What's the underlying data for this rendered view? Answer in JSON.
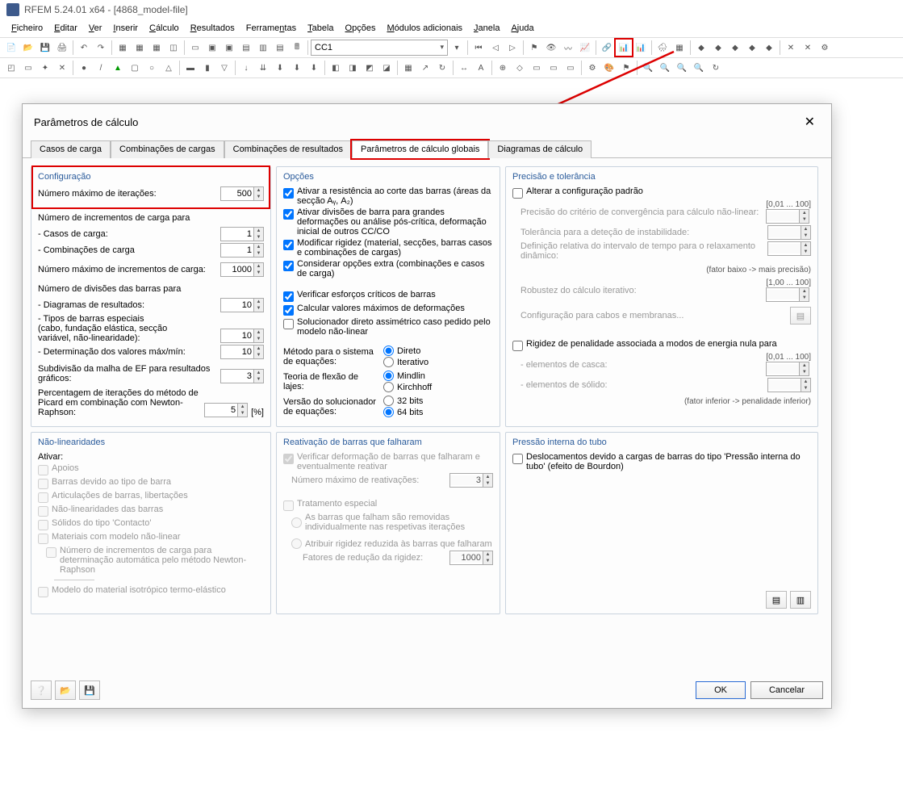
{
  "window": {
    "title": "RFEM 5.24.01 x64 - [4868_model-file]"
  },
  "menu": {
    "ficheiro": "Ficheiro",
    "editar": "Editar",
    "ver": "Ver",
    "inserir": "Inserir",
    "calculo": "Cálculo",
    "resultados": "Resultados",
    "ferramentas": "Ferramentas",
    "tabela": "Tabela",
    "opcoes": "Opções",
    "modulos": "Módulos adicionais",
    "janela": "Janela",
    "ajuda": "Ajuda"
  },
  "toolbar": {
    "combo_value": "CC1"
  },
  "dialog": {
    "title": "Parâmetros de cálculo",
    "close": "✕",
    "tabs": {
      "cces": "Casos de carga",
      "comb": "Combinações de cargas",
      "combres": "Combinações de resultados",
      "glob": "Parâmetros de cálculo globais",
      "diag": "Diagramas de cálculo"
    }
  },
  "config": {
    "hdr": "Configuração",
    "iter_lbl": "Número máximo de iterações:",
    "iter_val": "500",
    "incr_lbl": "Número de incrementos de carga para",
    "casos_lbl": "- Casos de carga:",
    "casos_val": "1",
    "comb_lbl": "- Combinações de carga",
    "comb_val": "1",
    "maxincr_lbl": "Número máximo de incrementos de carga:",
    "maxincr_val": "1000",
    "div_lbl": "Número de divisões das barras para",
    "diag_lbl": "- Diagramas de resultados:",
    "diag_val": "10",
    "tipos_lbl": "- Tipos de barras especiais\n  (cabo, fundação elástica, secção\n  variável, não-linearidade):",
    "tipos_val": "10",
    "det_lbl": "- Determinação dos valores máx/mín:",
    "det_val": "10",
    "malha_lbl": "Subdivisão da malha de EF para resultados gráficos:",
    "malha_val": "3",
    "pic_lbl": "Percentagem de iterações do método de Picard em combinação com Newton-Raphson:",
    "pic_val": "5",
    "pic_unit": "[%]"
  },
  "options": {
    "hdr": "Opções",
    "o1": "Ativar a resistência ao corte das barras (áreas da secção Aᵧ, A₂)",
    "o2": "Ativar divisões de barra para grandes deformações ou análise pós-crítica, deformação inicial de outros CC/CO",
    "o3": "Modificar rigidez (material, secções, barras casos e combinações de cargas)",
    "o4": "Considerar opções extra (combinações e casos de carga)",
    "o5": "Verificar esforços críticos de barras",
    "o6": "Calcular valores máximos de deformações",
    "o7": "Solucionador direto assimétrico caso pedido pelo modelo não-linear",
    "met_lbl": "Método para o sistema de equações:",
    "met_a": "Direto",
    "met_b": "Iterativo",
    "flex_lbl": "Teoria de flexão de lajes:",
    "flex_a": "Mindlin",
    "flex_b": "Kirchhoff",
    "ver_lbl": "Versão do solucionador de equações:",
    "ver_a": "32 bits",
    "ver_b": "64 bits"
  },
  "prec": {
    "hdr": "Precisão e tolerância",
    "alt": "Alterar a configuração padrão",
    "c1": "Precisão do critério de convergência para cálculo não-linear:",
    "r1": "[0,01 ... 100]",
    "c2": "Tolerância para a deteção de instabilidade:",
    "c3": "Definição relativa do intervalo de tempo para o relaxamento dinâmico:",
    "c3h": "(fator baixo -> mais precisão)",
    "c4": "Robustez do cálculo iterativo:",
    "r4": "[1,00 ... 100]",
    "cabo": "Configuração para cabos e membranas...",
    "rig": "Rigidez de penalidade associada a modos de energia nula para",
    "e1": "- elementos de casca:",
    "r5": "[0,01 ... 100]",
    "e2": "- elementos de sólido:",
    "rh": "(fator inferior -> penalidade inferior)"
  },
  "nonlin": {
    "hdr": "Não-linearidades",
    "at": "Ativar:",
    "n1": "Apoios",
    "n2": "Barras devido ao tipo de barra",
    "n3": "Articulações de barras, libertações",
    "n4": "Não-linearidades das barras",
    "n5": "Sólidos do tipo 'Contacto'",
    "n6": "Materiais com modelo não-linear",
    "n7": "Número de incrementos de carga para determinação automática pelo método Newton-Raphson",
    "n8": "Modelo do material isotrópico termo-elástico"
  },
  "react": {
    "hdr": "Reativação de barras que falharam",
    "r1": "Verificar deformação de barras que falharam e eventualmente reativar",
    "r2": "Número máximo de reativações:",
    "r2v": "3",
    "r3": "Tratamento especial",
    "r4": "As barras que falham são removidas individualmente nas respetivas iterações",
    "r5": "Atribuir rigidez reduzida às barras que falharam",
    "r6": "Fatores de redução da rigidez:",
    "r6v": "1000"
  },
  "tube": {
    "hdr": "Pressão interna do tubo",
    "t1": "Deslocamentos devido a cargas de barras do tipo 'Pressão interna do tubo' (efeito de Bourdon)"
  },
  "buttons": {
    "ok": "OK",
    "cancel": "Cancelar"
  }
}
